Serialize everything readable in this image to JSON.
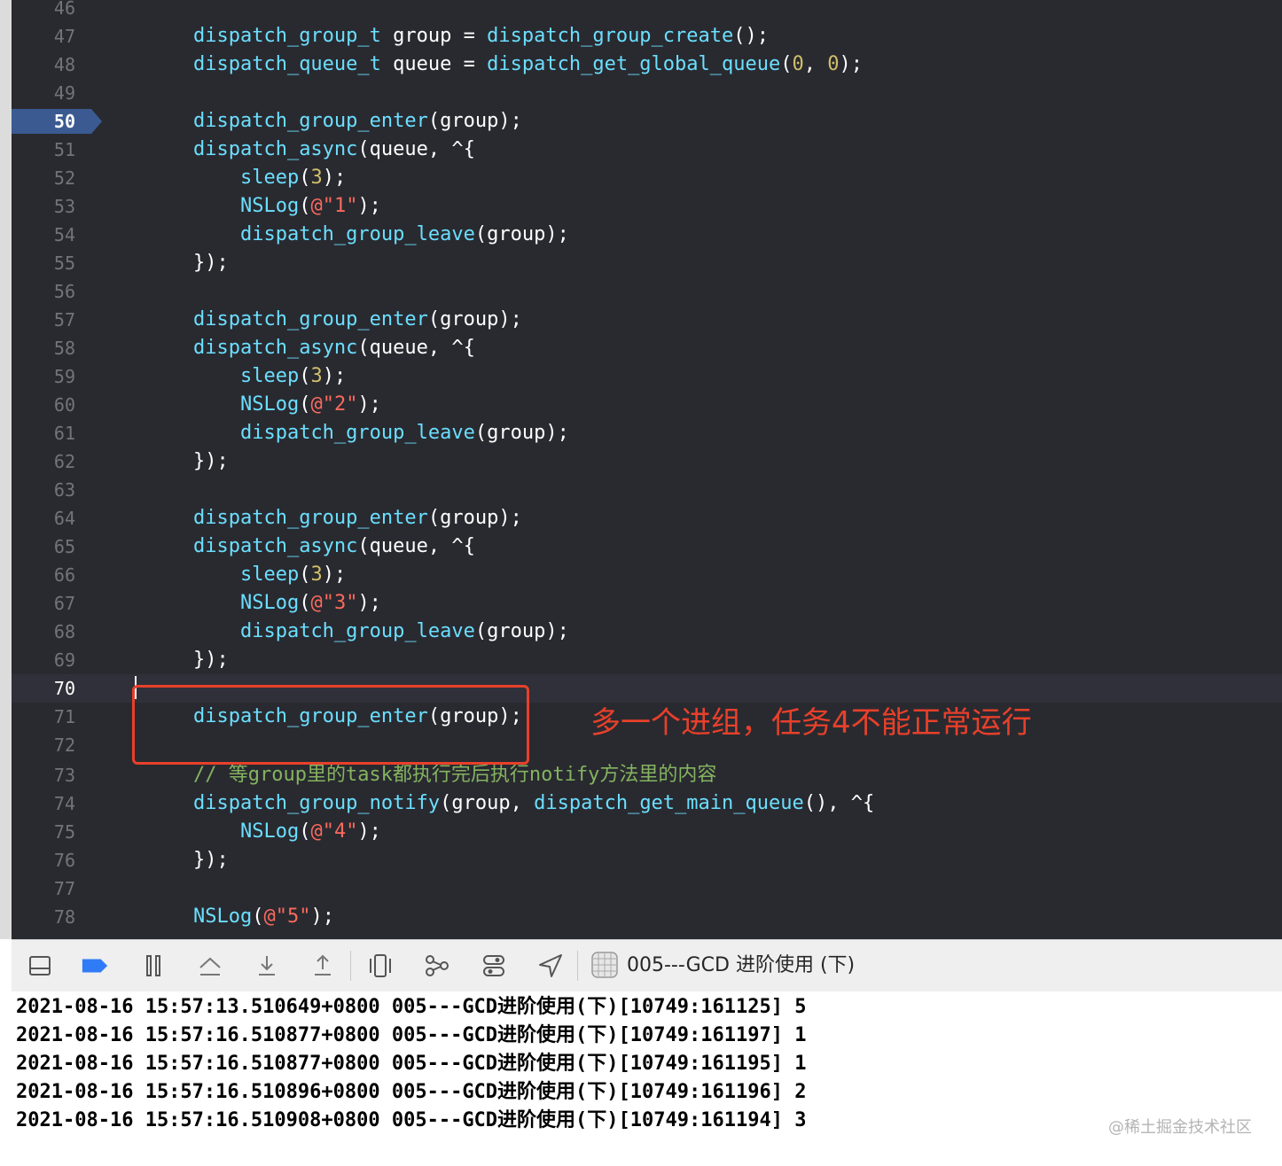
{
  "editor": {
    "lines": [
      {
        "n": "46",
        "tokens": []
      },
      {
        "n": "47",
        "tokens": [
          {
            "t": "    "
          },
          {
            "t": "dispatch_group_t",
            "c": "fn"
          },
          {
            "t": " group = "
          },
          {
            "t": "dispatch_group_create",
            "c": "fn"
          },
          {
            "t": "();"
          }
        ]
      },
      {
        "n": "48",
        "tokens": [
          {
            "t": "    "
          },
          {
            "t": "dispatch_queue_t",
            "c": "fn"
          },
          {
            "t": " queue = "
          },
          {
            "t": "dispatch_get_global_queue",
            "c": "fn"
          },
          {
            "t": "("
          },
          {
            "t": "0",
            "c": "num"
          },
          {
            "t": ", "
          },
          {
            "t": "0",
            "c": "num"
          },
          {
            "t": ");"
          }
        ]
      },
      {
        "n": "49",
        "tokens": []
      },
      {
        "n": "50",
        "bp": true,
        "tokens": [
          {
            "t": "    "
          },
          {
            "t": "dispatch_group_enter",
            "c": "fn"
          },
          {
            "t": "(group);"
          }
        ]
      },
      {
        "n": "51",
        "tokens": [
          {
            "t": "    "
          },
          {
            "t": "dispatch_async",
            "c": "fn"
          },
          {
            "t": "(queue, ^{"
          }
        ]
      },
      {
        "n": "52",
        "tokens": [
          {
            "t": "        "
          },
          {
            "t": "sleep",
            "c": "fn"
          },
          {
            "t": "("
          },
          {
            "t": "3",
            "c": "num"
          },
          {
            "t": ");"
          }
        ]
      },
      {
        "n": "53",
        "tokens": [
          {
            "t": "        "
          },
          {
            "t": "NSLog",
            "c": "fn"
          },
          {
            "t": "("
          },
          {
            "t": "@\"1\"",
            "c": "str"
          },
          {
            "t": ");"
          }
        ]
      },
      {
        "n": "54",
        "tokens": [
          {
            "t": "        "
          },
          {
            "t": "dispatch_group_leave",
            "c": "fn"
          },
          {
            "t": "(group);"
          }
        ]
      },
      {
        "n": "55",
        "tokens": [
          {
            "t": "    });"
          }
        ]
      },
      {
        "n": "56",
        "tokens": []
      },
      {
        "n": "57",
        "tokens": [
          {
            "t": "    "
          },
          {
            "t": "dispatch_group_enter",
            "c": "fn"
          },
          {
            "t": "(group);"
          }
        ]
      },
      {
        "n": "58",
        "tokens": [
          {
            "t": "    "
          },
          {
            "t": "dispatch_async",
            "c": "fn"
          },
          {
            "t": "(queue, ^{"
          }
        ]
      },
      {
        "n": "59",
        "tokens": [
          {
            "t": "        "
          },
          {
            "t": "sleep",
            "c": "fn"
          },
          {
            "t": "("
          },
          {
            "t": "3",
            "c": "num"
          },
          {
            "t": ");"
          }
        ]
      },
      {
        "n": "60",
        "tokens": [
          {
            "t": "        "
          },
          {
            "t": "NSLog",
            "c": "fn"
          },
          {
            "t": "("
          },
          {
            "t": "@\"2\"",
            "c": "str"
          },
          {
            "t": ");"
          }
        ]
      },
      {
        "n": "61",
        "tokens": [
          {
            "t": "        "
          },
          {
            "t": "dispatch_group_leave",
            "c": "fn"
          },
          {
            "t": "(group);"
          }
        ]
      },
      {
        "n": "62",
        "tokens": [
          {
            "t": "    });"
          }
        ]
      },
      {
        "n": "63",
        "tokens": []
      },
      {
        "n": "64",
        "tokens": [
          {
            "t": "    "
          },
          {
            "t": "dispatch_group_enter",
            "c": "fn"
          },
          {
            "t": "(group);"
          }
        ]
      },
      {
        "n": "65",
        "tokens": [
          {
            "t": "    "
          },
          {
            "t": "dispatch_async",
            "c": "fn"
          },
          {
            "t": "(queue, ^{"
          }
        ]
      },
      {
        "n": "66",
        "tokens": [
          {
            "t": "        "
          },
          {
            "t": "sleep",
            "c": "fn"
          },
          {
            "t": "("
          },
          {
            "t": "3",
            "c": "num"
          },
          {
            "t": ");"
          }
        ]
      },
      {
        "n": "67",
        "tokens": [
          {
            "t": "        "
          },
          {
            "t": "NSLog",
            "c": "fn"
          },
          {
            "t": "("
          },
          {
            "t": "@\"3\"",
            "c": "str"
          },
          {
            "t": ");"
          }
        ]
      },
      {
        "n": "68",
        "tokens": [
          {
            "t": "        "
          },
          {
            "t": "dispatch_group_leave",
            "c": "fn"
          },
          {
            "t": "(group);"
          }
        ]
      },
      {
        "n": "69",
        "tokens": [
          {
            "t": "    });"
          }
        ]
      },
      {
        "n": "70",
        "current": true,
        "tokens": []
      },
      {
        "n": "71",
        "tokens": [
          {
            "t": "    "
          },
          {
            "t": "dispatch_group_enter",
            "c": "fn"
          },
          {
            "t": "(group);"
          }
        ]
      },
      {
        "n": "72",
        "tokens": []
      },
      {
        "n": "73",
        "tokens": [
          {
            "t": "    "
          },
          {
            "t": "// 等group里的task都执行完后执行notify方法里的内容",
            "c": "com"
          }
        ]
      },
      {
        "n": "74",
        "tokens": [
          {
            "t": "    "
          },
          {
            "t": "dispatch_group_notify",
            "c": "fn"
          },
          {
            "t": "(group, "
          },
          {
            "t": "dispatch_get_main_queue",
            "c": "fn"
          },
          {
            "t": "(), ^{"
          }
        ]
      },
      {
        "n": "75",
        "tokens": [
          {
            "t": "        "
          },
          {
            "t": "NSLog",
            "c": "fn"
          },
          {
            "t": "("
          },
          {
            "t": "@\"4\"",
            "c": "str"
          },
          {
            "t": ");"
          }
        ]
      },
      {
        "n": "76",
        "tokens": [
          {
            "t": "    });"
          }
        ]
      },
      {
        "n": "77",
        "tokens": []
      },
      {
        "n": "78",
        "tokens": [
          {
            "t": "    "
          },
          {
            "t": "NSLog",
            "c": "fn"
          },
          {
            "t": "("
          },
          {
            "t": "@\"5\"",
            "c": "str"
          },
          {
            "t": ");"
          }
        ]
      }
    ]
  },
  "annotation": {
    "text": "多一个进组，任务4不能正常运行",
    "color": "#e8402a"
  },
  "toolbar": {
    "buttons": [
      "hide-debug-area-icon",
      "breakpoints-toggle-icon",
      "pause-icon",
      "step-over-icon",
      "step-into-icon",
      "step-out-icon",
      "view-hierarchy-icon",
      "memory-graph-icon",
      "environment-overrides-icon",
      "simulate-location-icon"
    ],
    "scheme_label": "005---GCD 进阶使用 (下)"
  },
  "console": {
    "lines": [
      "2021-08-16 15:57:13.510649+0800 005---GCD进阶使用(下)[10749:161125] 5",
      "2021-08-16 15:57:16.510877+0800 005---GCD进阶使用(下)[10749:161197] 1",
      "2021-08-16 15:57:16.510877+0800 005---GCD进阶使用(下)[10749:161195] 1",
      "2021-08-16 15:57:16.510896+0800 005---GCD进阶使用(下)[10749:161196] 2",
      "2021-08-16 15:57:16.510908+0800 005---GCD进阶使用(下)[10749:161194] 3"
    ]
  },
  "watermark": "@稀土掘金技术社区",
  "colors": {
    "editor_bg": "#292a30",
    "function": "#6bdfff",
    "number": "#d0bf69",
    "string": "#fc6a5d",
    "comment": "#84b360",
    "breakpoint": "#3b5a92"
  }
}
